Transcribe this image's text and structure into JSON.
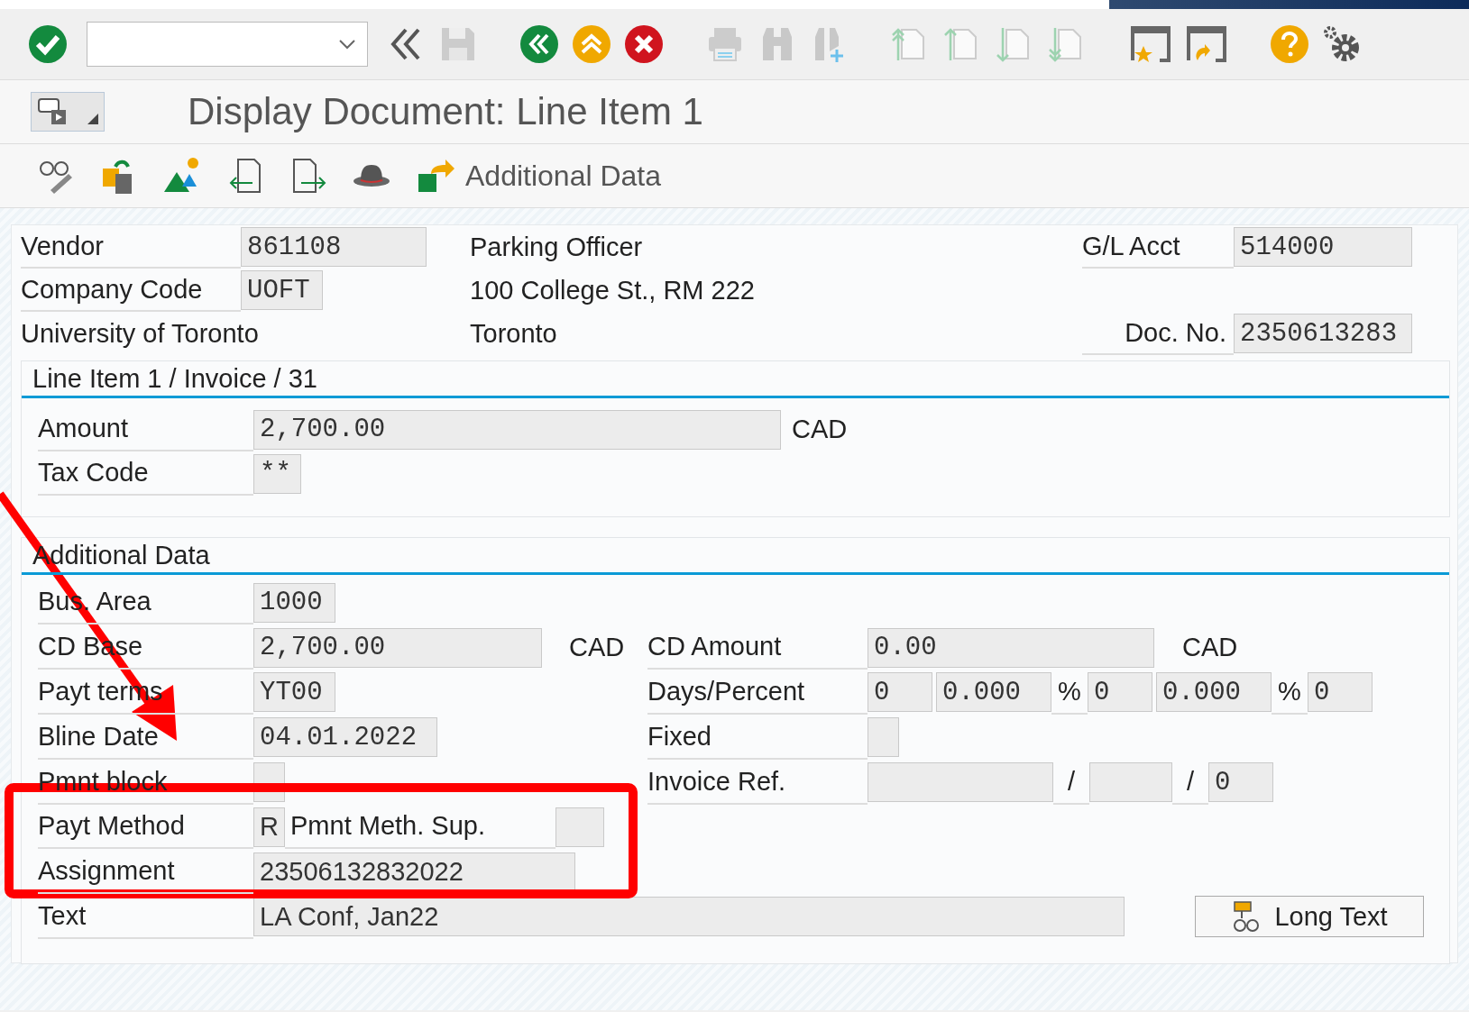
{
  "title": "Display Document: Line Item 1",
  "app_toolbar": {
    "additional_data": "Additional Data"
  },
  "header": {
    "vendor": {
      "label": "Vendor",
      "value": "861108"
    },
    "vendor_name": "Parking Officer",
    "gl_account": {
      "label": "G/L Acct",
      "value": "514000"
    },
    "company_code": {
      "label": "Company Code",
      "value": "UOFT"
    },
    "street": "100 College St., RM 222",
    "company_name": "University of Toronto",
    "city": "Toronto",
    "doc_no": {
      "label": "Doc. No.",
      "value": "2350613283"
    }
  },
  "line_item": {
    "title": "Line Item 1 / Invoice / 31",
    "amount": {
      "label": "Amount",
      "value": "2,700.00",
      "currency": "CAD"
    },
    "tax_code": {
      "label": "Tax Code",
      "value": "**"
    }
  },
  "additional_data": {
    "title": "Additional Data",
    "bus_area": {
      "label": "Bus. Area",
      "value": "1000"
    },
    "cd_base": {
      "label": "CD Base",
      "value": "2,700.00",
      "currency": "CAD"
    },
    "payt_terms": {
      "label": "Payt terms",
      "value": "YT00"
    },
    "bline_date": {
      "label": "Bline Date",
      "value": "04.01.2022"
    },
    "pmnt_block": {
      "label": "Pmnt block"
    },
    "payt_method": {
      "label": "Payt Method",
      "value": "R",
      "sup_label": "Pmnt Meth. Sup."
    },
    "assignment": {
      "label": "Assignment",
      "value": "23506132832022"
    },
    "text": {
      "label": "Text",
      "value": "LA Conf, Jan22"
    },
    "cd_amount": {
      "label": "CD Amount",
      "value": "0.00",
      "currency": "CAD"
    },
    "days_percent": {
      "label": "Days/Percent",
      "days_1": "0",
      "percent_1": "0.000",
      "percent_sign_1": "%",
      "days_2": "0",
      "percent_2": "0.000",
      "percent_sign_2": "%",
      "days_3": "0"
    },
    "fixed": {
      "label": "Fixed"
    },
    "invoice_ref": {
      "label": "Invoice Ref.",
      "separator_1": "/",
      "separator_2": "/",
      "item": "0"
    },
    "long_text_button": "Long Text"
  },
  "annotations": {
    "arrow": true,
    "box": true
  }
}
